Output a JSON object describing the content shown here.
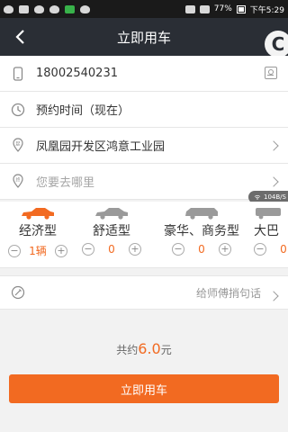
{
  "status_bar": {
    "battery": "77%",
    "time": "下午5:29"
  },
  "nav": {
    "title": "立即用车",
    "badge_letter": "C"
  },
  "form": {
    "phone": "18002540231",
    "time": "预约时间（现在）",
    "origin": "凤凰园开发区鸿意工业园",
    "destination_placeholder": "您要去哪里"
  },
  "network_speed": "104B/S",
  "cars": [
    {
      "name": "经济型",
      "count": "1辆",
      "color": "#f26a21"
    },
    {
      "name": "舒适型",
      "count": "0",
      "color": "#9a9a9a"
    },
    {
      "name": "豪华、商务型",
      "count": "0",
      "color": "#9a9a9a"
    },
    {
      "name": "大巴",
      "count": "0",
      "color": "#9a9a9a"
    }
  ],
  "note_placeholder": "给师傅捎句话",
  "total": {
    "prefix": "共约",
    "amount": "6.0",
    "unit": "元"
  },
  "submit_label": "立即用车",
  "colors": {
    "accent": "#f26a21",
    "nav_bg": "#2a2e35"
  }
}
